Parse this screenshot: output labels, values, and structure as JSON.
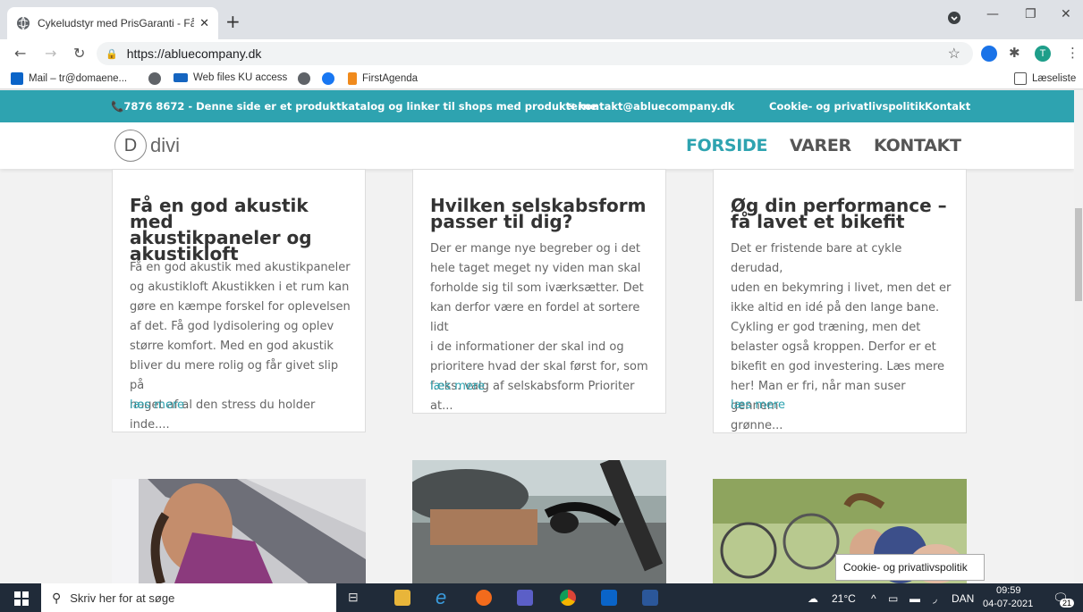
{
  "browser": {
    "tab_title": "Cykeludstyr med PrisGaranti - Få",
    "url": "https://abluecompany.dk",
    "bookmarks": [
      {
        "label": "Mail – tr@domaene..."
      },
      {
        "label": ""
      },
      {
        "label": "Web files KU access"
      },
      {
        "label": ""
      },
      {
        "label": ""
      },
      {
        "label": "FirstAgenda"
      }
    ],
    "reading_list": "Læseliste",
    "profile_initial": "T"
  },
  "site": {
    "topbar": {
      "phone": "7876 8672 - Denne side er et produktkatalog og linker til shops med produkterne",
      "email": "kontakt@abluecompany.dk",
      "cookie": "Cookie- og privatlivspolitik",
      "contact": "Kontakt"
    },
    "logo": {
      "letter": "D",
      "word": "divi"
    },
    "nav": [
      {
        "label": "FORSIDE"
      },
      {
        "label": "VARER"
      },
      {
        "label": "KONTAKT"
      }
    ],
    "cards": [
      {
        "title_lines": [
          "Få en god akustik med",
          "akustikpaneler og",
          "akustikloft"
        ],
        "text_lines": [
          "Få en god akustik med akustikpaneler",
          "og akustikloft Akustikken i et rum kan",
          "gøre en kæmpe forskel for oplevelsen",
          "af det. Få god lydisolering og oplev",
          "større komfort. Med en god akustik",
          "bliver du mere rolig og får givet slip på",
          "noget af al den stress du holder inde...."
        ],
        "link": "læs mere"
      },
      {
        "title_lines": [
          "Hvilken selskabsform",
          "passer til dig?"
        ],
        "text_lines": [
          "Der er mange nye begreber og i det",
          "hele taget meget ny viden man skal",
          "forholde sig til som iværksætter. Det",
          "kan derfor være en fordel at sortere lidt",
          "i de informationer der skal ind og",
          "prioritere hvad der skal først for, som",
          "f.eks. valg af selskabsform Prioriter at..."
        ],
        "link": "læs mere"
      },
      {
        "title_lines": [
          "Øg din performance –",
          "få lavet et bikefit"
        ],
        "text_lines": [
          "Det er fristende bare at cykle derudad,",
          "uden en bekymring i livet, men det er",
          "ikke altid en idé på den lange bane.",
          "Cykling er god træning, men det",
          "belaster også kroppen. Derfor er et",
          "bikefit en god investering. Læs mere",
          "her!  Man er fri, når man suser gennem",
          "grønne..."
        ],
        "link": "læs mere"
      }
    ],
    "tooltip": "Cookie- og privatlivspolitik"
  },
  "taskbar": {
    "search_placeholder": "Skriv her for at søge",
    "weather": "21°C",
    "language": "DAN",
    "time": "09:59",
    "date": "04-07-2021",
    "notifications": "21"
  },
  "colors": {
    "accent": "#2ea3b0",
    "taskbar": "#202b39"
  }
}
